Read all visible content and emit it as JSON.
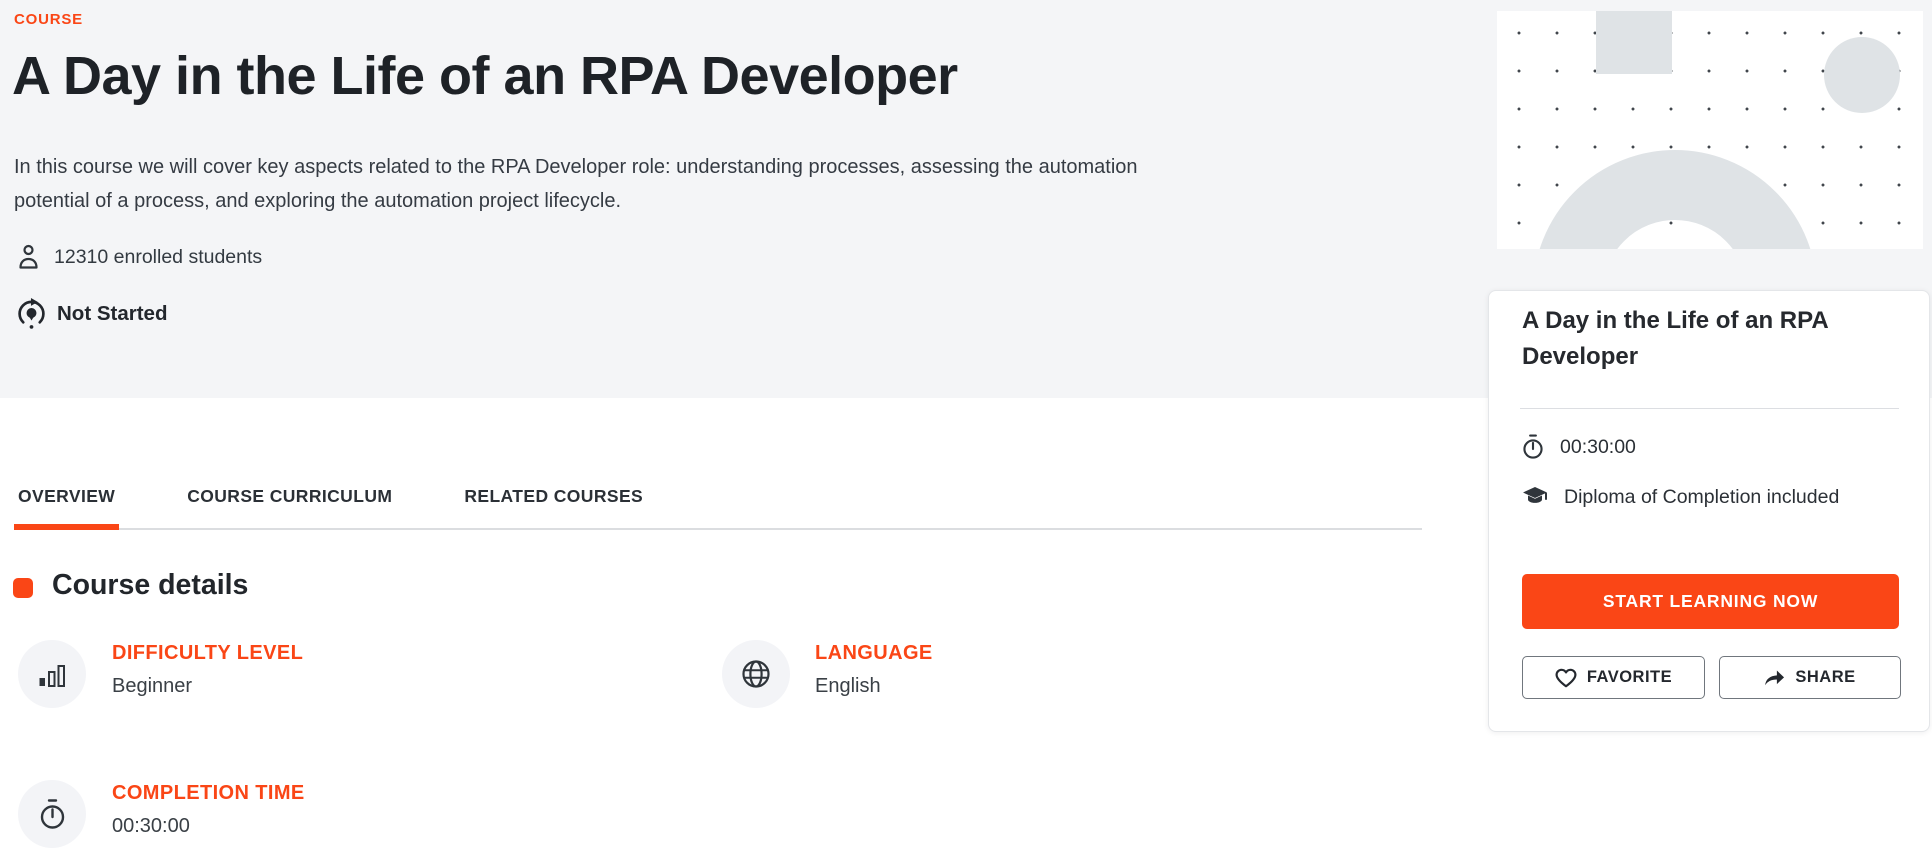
{
  "theme": {
    "accent_color": "#FA4616",
    "header_background": "#F4F5F7",
    "decor_shape_color": "#DFE3E6"
  },
  "header": {
    "eyebrow": "COURSE",
    "title": "A Day in the Life of an RPA Developer",
    "description": "In this course we will cover key aspects related to the RPA Developer role: understanding processes, assessing the automation potential of a process, and exploring the automation project lifecycle.",
    "enrolled": "12310 enrolled students",
    "status": "Not Started"
  },
  "tabs": [
    {
      "label": "OVERVIEW",
      "active": true
    },
    {
      "label": "COURSE CURRICULUM",
      "active": false
    },
    {
      "label": "RELATED COURSES",
      "active": false
    }
  ],
  "overview": {
    "section_title": "Course details",
    "details": [
      {
        "icon": "bar-chart-icon",
        "label": "DIFFICULTY LEVEL",
        "value": "Beginner"
      },
      {
        "icon": "globe-icon",
        "label": "LANGUAGE",
        "value": "English"
      },
      {
        "icon": "stopwatch-icon",
        "label": "COMPLETION TIME",
        "value": "00:30:00"
      }
    ]
  },
  "card": {
    "title": "A Day in the Life of an RPA Developer",
    "duration": "00:30:00",
    "diploma": "Diploma of Completion included",
    "cta_label": "START LEARNING NOW",
    "favorite_label": "FAVORITE",
    "share_label": "SHARE"
  }
}
